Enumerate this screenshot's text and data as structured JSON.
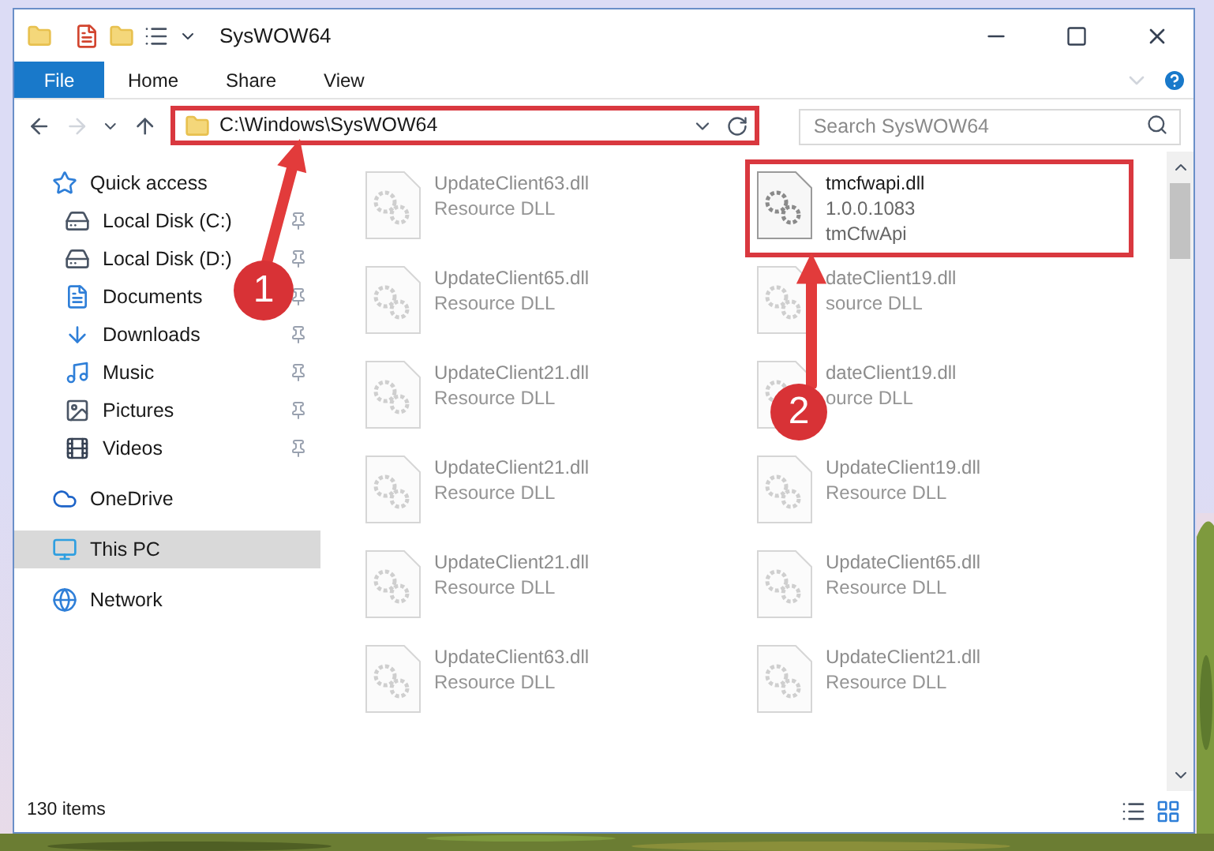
{
  "window": {
    "title": "SysWOW64"
  },
  "ribbon_tabs": [
    {
      "label": "File",
      "selected": true
    },
    {
      "label": "Home",
      "selected": false
    },
    {
      "label": "Share",
      "selected": false
    },
    {
      "label": "View",
      "selected": false
    }
  ],
  "address": {
    "path": "C:\\Windows\\SysWOW64"
  },
  "search": {
    "placeholder": "Search SysWOW64"
  },
  "sidebar": {
    "items": [
      {
        "label": "Quick access",
        "pinned": false,
        "selected": false,
        "children": [
          {
            "label": "Local Disk (C:)",
            "pinned": true,
            "selected": false
          },
          {
            "label": "Local Disk (D:)",
            "pinned": true,
            "selected": false
          },
          {
            "label": "Documents",
            "pinned": true,
            "selected": false
          },
          {
            "label": "Downloads",
            "pinned": true,
            "selected": false
          },
          {
            "label": "Music",
            "pinned": true,
            "selected": false
          },
          {
            "label": "Pictures",
            "pinned": true,
            "selected": false
          },
          {
            "label": "Videos",
            "pinned": true,
            "selected": false
          }
        ]
      },
      {
        "label": "OneDrive",
        "pinned": false,
        "selected": false
      },
      {
        "label": "This PC",
        "pinned": false,
        "selected": true
      },
      {
        "label": "Network",
        "pinned": false,
        "selected": false
      }
    ]
  },
  "files": [
    {
      "name": "UpdateClient63.dll",
      "line_2": "Resource DLL",
      "highlighted": false
    },
    {
      "name": "tmcfwapi.dll",
      "line_2": "1.0.0.1083",
      "line_3": "tmCfwApi",
      "highlighted": true
    },
    {
      "name": "UpdateClient65.dll",
      "line_2": "Resource DLL",
      "highlighted": false
    },
    {
      "name": "dateClient19.dll",
      "line_2": "source DLL",
      "highlighted": false
    },
    {
      "name": "UpdateClient21.dll",
      "line_2": "Resource DLL",
      "highlighted": false
    },
    {
      "name": "dateClient19.dll",
      "line_2": "ource DLL",
      "highlighted": false
    },
    {
      "name": "UpdateClient21.dll",
      "line_2": "Resource DLL",
      "highlighted": false
    },
    {
      "name": "UpdateClient19.dll",
      "line_2": "Resource DLL",
      "highlighted": false
    },
    {
      "name": "UpdateClient21.dll",
      "line_2": "Resource DLL",
      "highlighted": false
    },
    {
      "name": "UpdateClient65.dll",
      "line_2": "Resource DLL",
      "highlighted": false
    },
    {
      "name": "UpdateClient63.dll",
      "line_2": "Resource DLL",
      "highlighted": false
    },
    {
      "name": "UpdateClient21.dll",
      "line_2": "Resource DLL",
      "highlighted": false
    }
  ],
  "status_bar": {
    "count": "130 items"
  },
  "annotations": [
    {
      "number": "1"
    },
    {
      "number": "2"
    }
  ]
}
